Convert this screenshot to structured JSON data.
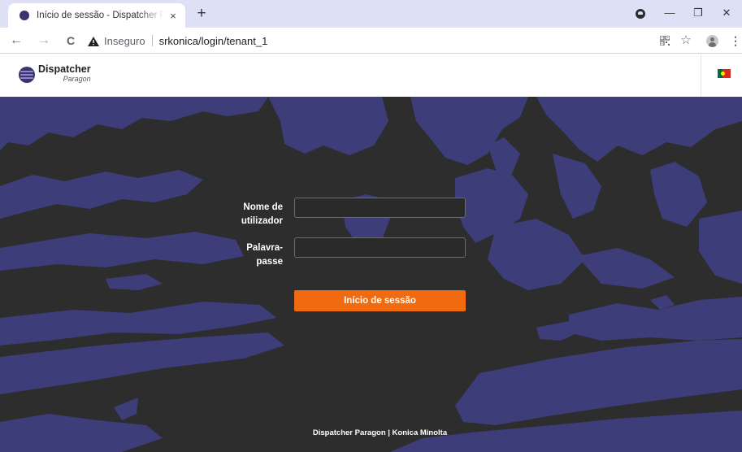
{
  "browser": {
    "tab_title": "Início de sessão - Dispatcher Paragon",
    "tab_close": "×",
    "new_tab": "+",
    "nav": {
      "back": "←",
      "forward": "→",
      "reload": "C"
    },
    "security_label": "Inseguro",
    "url": "srkonica/login/tenant_1",
    "window_controls": {
      "minimize": "—",
      "maximize": "❐",
      "close": "✕"
    },
    "toolbar_icons": [
      "qr-code-icon",
      "star-icon",
      "profile-icon",
      "more-icon"
    ]
  },
  "app": {
    "logo_name": "Dispatcher",
    "logo_sub": "Paragon",
    "language_flag": "portugal-flag"
  },
  "login": {
    "username_label": "Nome de utilizador",
    "username_value": "",
    "password_label": "Palavra-passe",
    "password_value": "",
    "submit_label": "Início de sessão"
  },
  "footer": {
    "text": "Dispatcher Paragon | Konica Minolta"
  },
  "colors": {
    "accent": "#f26a10",
    "background": "#2d2d2d",
    "pattern": "#3d3d7a"
  }
}
